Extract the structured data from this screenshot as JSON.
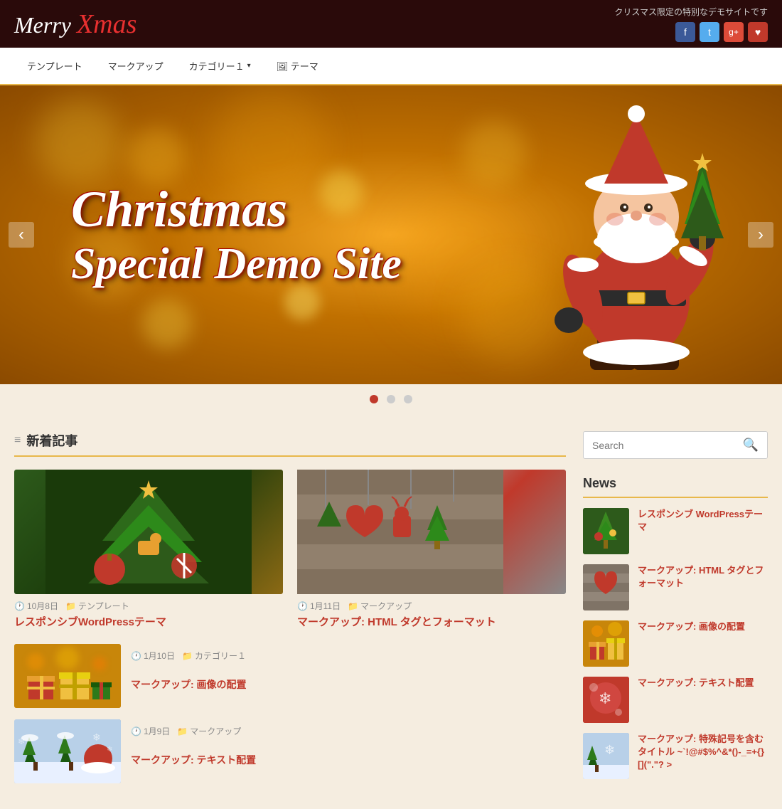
{
  "site": {
    "logo_merry": "Merry",
    "logo_xmas": "Xmas",
    "tagline": "クリスマス限定の特別なデモサイトです"
  },
  "social": {
    "icons": [
      "f",
      "t",
      "g+",
      "♥"
    ]
  },
  "nav": {
    "items": [
      {
        "label": "テンプレート",
        "has_dropdown": false
      },
      {
        "label": "マークアップ",
        "has_dropdown": false
      },
      {
        "label": "カテゴリー１",
        "has_dropdown": true
      },
      {
        "label": "🖼 テーマ",
        "has_dropdown": false
      }
    ]
  },
  "hero": {
    "title_line1": "Christmas",
    "title_line2": "Special Demo Site",
    "prev_label": "‹",
    "next_label": "›"
  },
  "slider": {
    "dots": [
      1,
      2,
      3
    ],
    "active": 0
  },
  "content": {
    "section_title": "新着記事",
    "articles_grid": [
      {
        "date": "10月8日",
        "category": "テンプレート",
        "title": "レスポンシブWordPressテーマ",
        "img_class": "img-ornament1"
      },
      {
        "date": "1月11日",
        "category": "マークアップ",
        "title": "マークアップ: HTML タグとフォーマット",
        "img_class": "img-ornament2"
      }
    ],
    "articles_list": [
      {
        "date": "1月10日",
        "category": "カテゴリー１",
        "title": "マークアップ: 画像の配置",
        "img_class": "img-gifts"
      },
      {
        "date": "1月9日",
        "category": "マークアップ",
        "title": "マークアップ: テキスト配置",
        "img_class": "img-winter"
      }
    ]
  },
  "sidebar": {
    "search_placeholder": "Search",
    "search_btn_icon": "🔍",
    "news_title": "News",
    "news_items": [
      {
        "title": "レスポンシブ WordPressテーマ",
        "img_class": "img-news1"
      },
      {
        "title": "マークアップ: HTML タグとフォーマット",
        "img_class": "img-news2"
      },
      {
        "title": "マークアップ: 画像の配置",
        "img_class": "img-news3"
      },
      {
        "title": "マークアップ: テキスト配置",
        "img_class": "img-news4"
      },
      {
        "title": "マークアップ: 特殊記号を含むタイトル ~`!@#$%^&*()-_=+{}[](\".\"? >",
        "img_class": "img-news5"
      }
    ]
  }
}
